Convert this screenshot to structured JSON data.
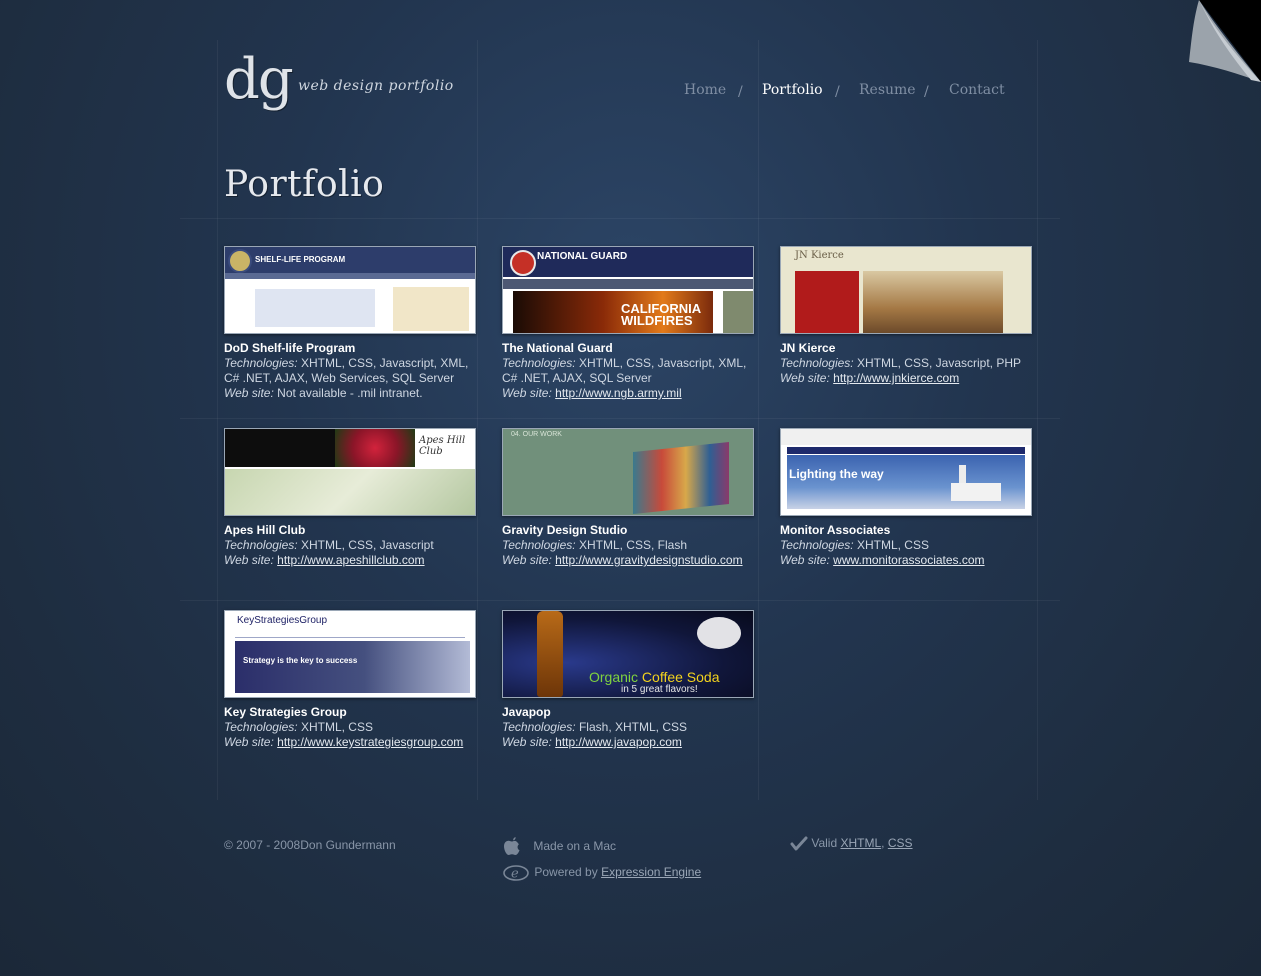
{
  "logo": {
    "mark": "dg",
    "tagline": "web design portfolio"
  },
  "nav": [
    {
      "label": "Home",
      "active": false
    },
    {
      "label": "Portfolio",
      "active": true
    },
    {
      "label": "Resume",
      "active": false
    },
    {
      "label": "Contact",
      "active": false
    }
  ],
  "nav_separator": "/",
  "page_title": "Portfolio",
  "tech_label": "Technologies:",
  "web_label": "Web site:",
  "projects": [
    {
      "title": "DoD Shelf-life Program",
      "tech_1": "XHTML, CSS, Javascript, XML,",
      "tech_2": "C# .NET, AJAX, Web Services, SQL Server",
      "site": "Not available - .mil intranet."
    },
    {
      "title": "The National Guard",
      "tech_1": "XHTML, CSS, Javascript, XML,",
      "tech_2": "C# .NET, AJAX, SQL Server",
      "site": "http://www.ngb.army.mil"
    },
    {
      "title": "JN Kierce",
      "tech_1": "XHTML, CSS, Javascript, PHP",
      "site": "http://www.jnkierce.com"
    },
    {
      "title": "Apes Hill Club",
      "tech_1": "XHTML, CSS, Javascript",
      "site": "http://www.apeshillclub.com"
    },
    {
      "title": "Gravity Design Studio",
      "tech_1": "XHTML, CSS, Flash",
      "site": "http://www.gravitydesignstudio.com"
    },
    {
      "title": "Monitor Associates",
      "tech_1": "XHTML, CSS",
      "site": "www.monitorassociates.com"
    },
    {
      "title": "Key Strategies Group",
      "tech_1": "XHTML, CSS",
      "site": "http://www.keystrategiesgroup.com"
    },
    {
      "title": "Javapop",
      "tech_1": "Flash, XHTML, CSS",
      "site": "http://www.javapop.com"
    }
  ],
  "thumbnails": {
    "dod": "SHELF-LIFE PROGRAM",
    "guard_title": "NATIONAL GUARD",
    "guard_banner_1": "CALIFORNIA",
    "guard_banner_2": "WILDFIRES",
    "jnk": "JN Kierce",
    "apes": "Apes Hill Club",
    "gravity": "04. OUR WORK",
    "monitor": "Lighting the way",
    "ksg": "KeyStrategiesGroup",
    "ksg_banner": "Strategy is the key to success",
    "javapop_organic": "Organic",
    "javapop_coffee": "Coffee Soda",
    "javapop_flavors": "in 5 great flavors!"
  },
  "footer": {
    "copyright": "© 2007 - 2008Don Gundermann",
    "made_on_mac": "Made on a Mac",
    "powered_by": "Powered by",
    "engine": "Expression Engine",
    "valid": "Valid",
    "xhtml": "XHTML",
    "css": "CSS",
    "comma": ","
  },
  "icons": [
    "apple-icon",
    "expression-engine-icon",
    "checkmark-icon",
    "page-curl-icon"
  ]
}
